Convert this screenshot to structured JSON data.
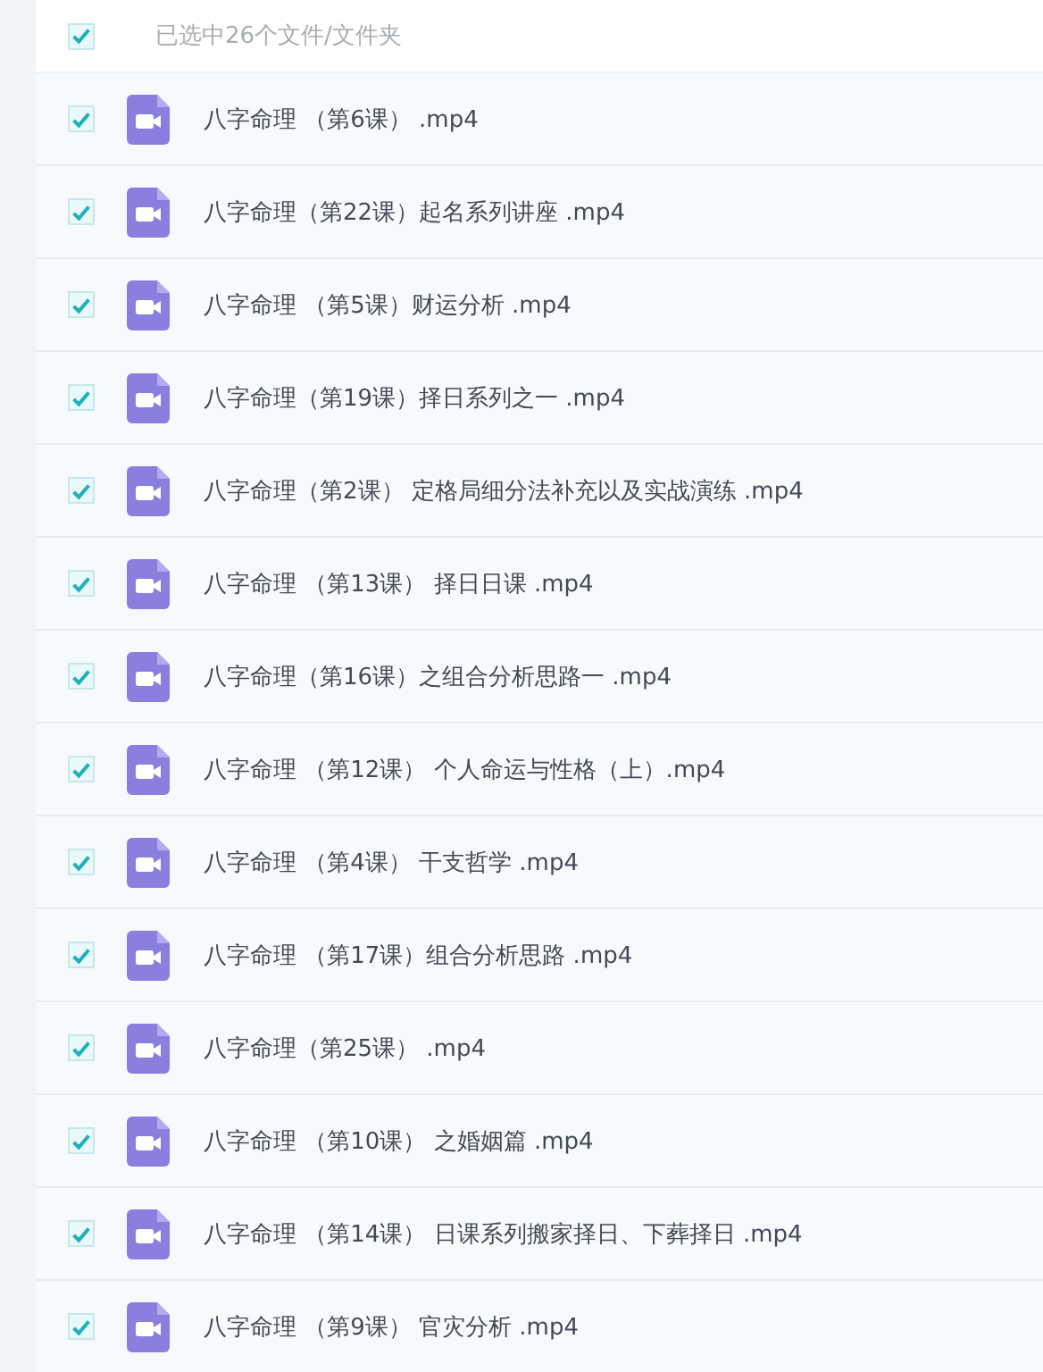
{
  "header": {
    "checked": true,
    "label": "已选中26个文件/文件夹"
  },
  "files": [
    {
      "name": "八字命理 （第6课） .mp4",
      "checked": true
    },
    {
      "name": "八字命理（第22课）起名系列讲座 .mp4",
      "checked": true
    },
    {
      "name": "八字命理 （第5课）财运分析 .mp4",
      "checked": true
    },
    {
      "name": "八字命理（第19课）择日系列之一 .mp4",
      "checked": true
    },
    {
      "name": "八字命理（第2课） 定格局细分法补充以及实战演练 .mp4",
      "checked": true
    },
    {
      "name": "八字命理 （第13课） 择日日课 .mp4",
      "checked": true
    },
    {
      "name": "八字命理（第16课）之组合分析思路一 .mp4",
      "checked": true
    },
    {
      "name": "八字命理 （第12课） 个人命运与性格（上）.mp4",
      "checked": true
    },
    {
      "name": "八字命理 （第4课） 干支哲学 .mp4",
      "checked": true
    },
    {
      "name": "八字命理 （第17课）组合分析思路 .mp4",
      "checked": true
    },
    {
      "name": "八字命理（第25课） .mp4",
      "checked": true
    },
    {
      "name": "八字命理 （第10课） 之婚姻篇 .mp4",
      "checked": true
    },
    {
      "name": "八字命理 （第14课） 日课系列搬家择日、下葬择日 .mp4",
      "checked": true
    },
    {
      "name": "八字命理 （第9课） 官灾分析 .mp4",
      "checked": true
    }
  ]
}
